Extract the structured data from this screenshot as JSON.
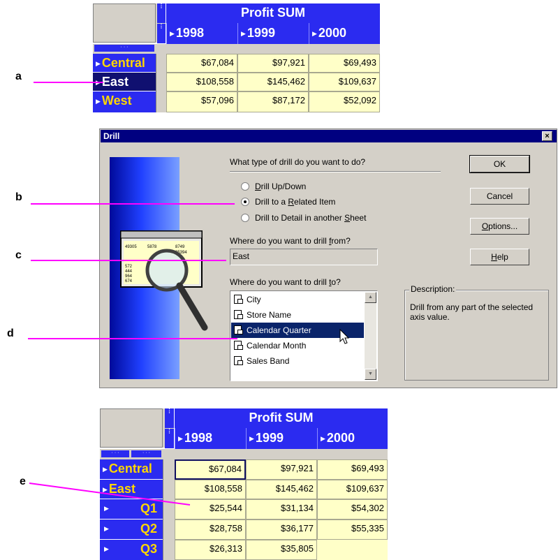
{
  "table1": {
    "title": "Profit SUM",
    "years": [
      "1998",
      "1999",
      "2000"
    ],
    "rows": [
      {
        "label": "Central",
        "values": [
          "$67,084",
          "$97,921",
          "$69,493"
        ]
      },
      {
        "label": "East",
        "values": [
          "$108,558",
          "$145,462",
          "$109,637"
        ]
      },
      {
        "label": "West",
        "values": [
          "$57,096",
          "$87,172",
          "$52,092"
        ]
      }
    ]
  },
  "callouts": {
    "a": "a",
    "b": "b",
    "c": "c",
    "d": "d",
    "e": "e"
  },
  "dialog": {
    "title": "Drill",
    "close": "×",
    "question": "What type of drill do you want to do?",
    "options": [
      {
        "pre": "",
        "key": "D",
        "post": "rill Up/Down",
        "selected": false
      },
      {
        "pre": "Drill to a ",
        "key": "R",
        "post": "elated Item",
        "selected": true
      },
      {
        "pre": "Drill to Detail in another ",
        "key": "S",
        "post": "heet",
        "selected": false
      }
    ],
    "from_label": {
      "pre": "Where do you want to drill ",
      "key": "f",
      "post": "rom?"
    },
    "from_value": "East",
    "to_label": {
      "pre": "Where do you want to drill ",
      "key": "t",
      "post": "o?"
    },
    "items": [
      "City",
      "Store Name",
      "Calendar Quarter",
      "Calendar Month",
      "Sales Band"
    ],
    "selected_item": "Calendar Quarter",
    "buttons": {
      "ok": "OK",
      "cancel": "Cancel",
      "options": {
        "pre": "",
        "key": "O",
        "post": "ptions..."
      },
      "help": {
        "pre": "",
        "key": "H",
        "post": "elp"
      }
    },
    "description_label": "Description:",
    "description_text": "Drill from any part of the selected axis value.",
    "image_numbers": [
      "49305",
      "5878",
      "8749",
      "85394",
      "572",
      "444",
      "964",
      "674"
    ]
  },
  "table2": {
    "title": "Profit SUM",
    "years": [
      "1998",
      "1999",
      "2000"
    ],
    "rows": [
      {
        "label": "Central",
        "values": [
          "$67,084",
          "$97,921",
          "$69,493"
        ]
      },
      {
        "label": "East",
        "values": [
          "$108,558",
          "$145,462",
          "$109,637"
        ]
      },
      {
        "label": "Q1",
        "values": [
          "$25,544",
          "$31,134",
          "$54,302"
        ]
      },
      {
        "label": "Q2",
        "values": [
          "$28,758",
          "$36,177",
          "$55,335"
        ]
      },
      {
        "label": "Q3",
        "values": [
          "$26,313",
          "$35,805",
          ""
        ]
      }
    ]
  },
  "colors": {
    "header_blue": "#2b2bf0",
    "cell_yellow": "#ffffc8",
    "row_label": "#ffd700",
    "callout_line": "#ff00ff",
    "titlebar": "#000080"
  },
  "icons": {
    "row_marker": "triangle-right-icon",
    "list_item": "dimension-icon",
    "cursor": "arrow-cursor-icon",
    "dialog_art": "magnifier-icon"
  }
}
